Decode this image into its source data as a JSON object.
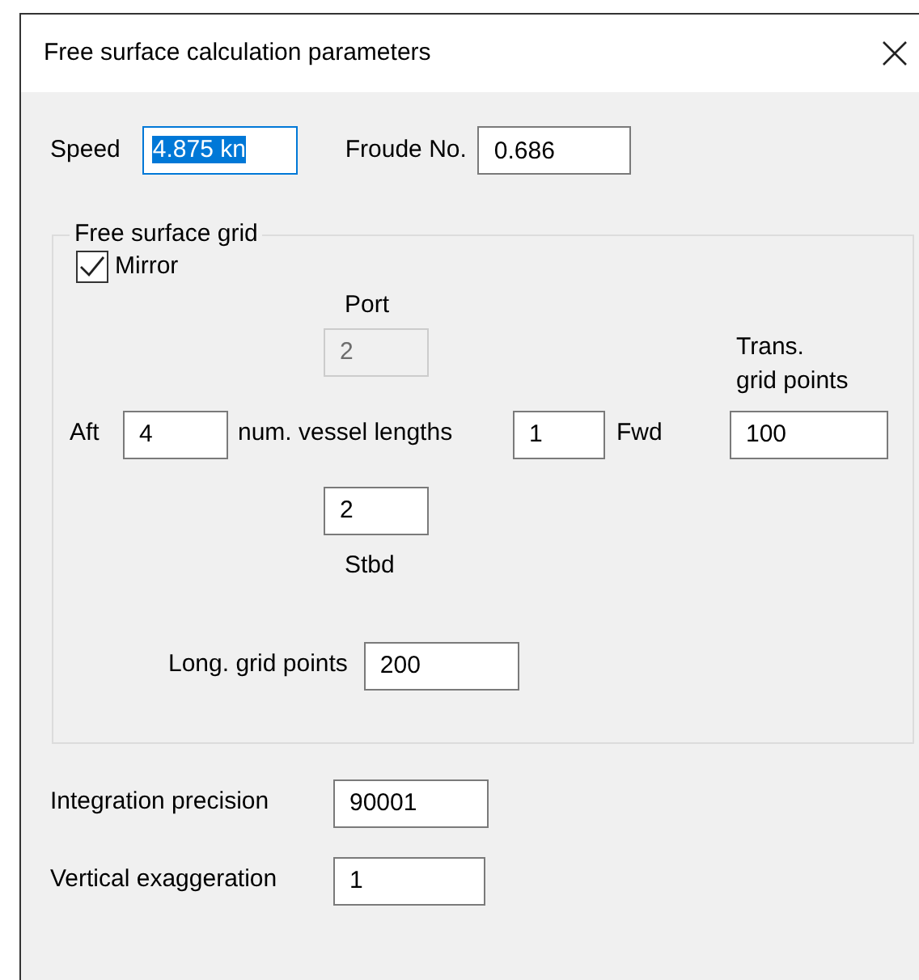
{
  "window": {
    "title": "Free surface calculation parameters"
  },
  "speed": {
    "label": "Speed",
    "value": "4.875 kn",
    "text_selected": true
  },
  "froude": {
    "label": "Froude No.",
    "value": "0.686",
    "disabled": false
  },
  "grid": {
    "title": "Free surface grid",
    "mirror": {
      "label": "Mirror",
      "checked": true
    },
    "port": {
      "label": "Port",
      "value": "2",
      "disabled": true
    },
    "aft": {
      "label": "Aft",
      "value": "4",
      "disabled": false
    },
    "vessel_lengths_label": "num. vessel lengths",
    "fwd": {
      "label": "Fwd",
      "value": "1",
      "disabled": false
    },
    "trans": {
      "label_lines": [
        "Trans.",
        "grid points"
      ],
      "value": "100",
      "disabled": false
    },
    "stbd": {
      "label": "Stbd",
      "value": "2",
      "disabled": false
    },
    "long": {
      "label": "Long. grid points",
      "value": "200",
      "disabled": false
    }
  },
  "integration": {
    "label": "Integration precision",
    "value": "90001",
    "disabled": false
  },
  "vertical": {
    "label": "Vertical exaggeration",
    "value": "1",
    "disabled": false
  }
}
